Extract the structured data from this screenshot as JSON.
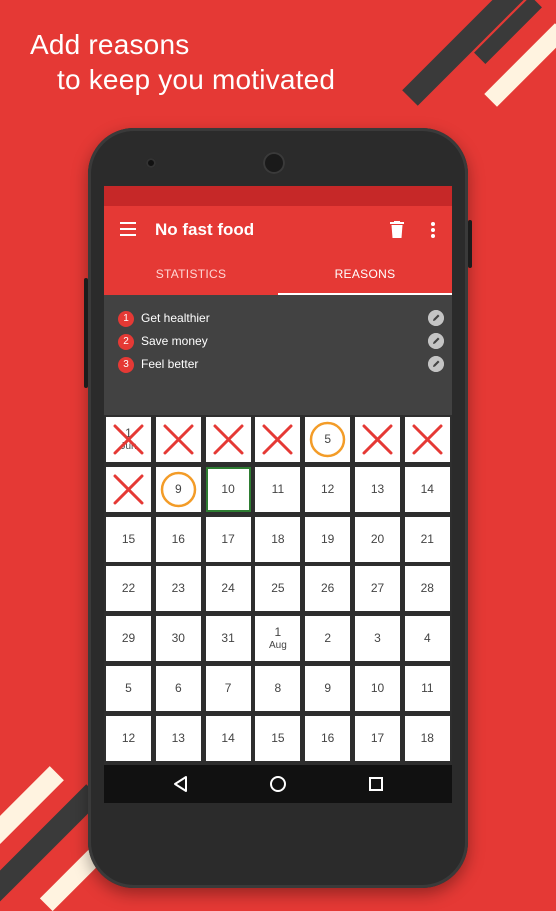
{
  "headline": {
    "line1": "Add reasons",
    "line2": "to keep you motivated"
  },
  "colors": {
    "background": "#e53935",
    "toolbar": "#e53935",
    "status_bar": "#c62828",
    "accent_x": "#e53935",
    "accent_circle": "#f39c28",
    "today_border": "#2e7d32"
  },
  "toolbar": {
    "menu_icon": "hamburger-menu-icon",
    "title": "No fast food",
    "delete_icon": "trash-icon",
    "overflow_icon": "more-vert-icon"
  },
  "tabs": [
    {
      "label": "STATISTICS",
      "active": false
    },
    {
      "label": "REASONS",
      "active": true
    }
  ],
  "reasons": [
    {
      "num": "1",
      "text": "Get healthier"
    },
    {
      "num": "2",
      "text": "Save money"
    },
    {
      "num": "3",
      "text": "Feel better"
    }
  ],
  "calendar": {
    "cells": [
      {
        "day": "1",
        "sub": "Jun",
        "mark": "x"
      },
      {
        "day": "",
        "sub": "",
        "mark": "x"
      },
      {
        "day": "",
        "sub": "",
        "mark": "x"
      },
      {
        "day": "",
        "sub": "",
        "mark": "x"
      },
      {
        "day": "5",
        "sub": "",
        "mark": "o"
      },
      {
        "day": "",
        "sub": "",
        "mark": "x"
      },
      {
        "day": "",
        "sub": "",
        "mark": "x"
      },
      {
        "day": "",
        "sub": "",
        "mark": "x"
      },
      {
        "day": "9",
        "sub": "",
        "mark": "o"
      },
      {
        "day": "10",
        "sub": "",
        "mark": "today"
      },
      {
        "day": "11",
        "sub": "",
        "mark": ""
      },
      {
        "day": "12",
        "sub": "",
        "mark": ""
      },
      {
        "day": "13",
        "sub": "",
        "mark": ""
      },
      {
        "day": "14",
        "sub": "",
        "mark": ""
      },
      {
        "day": "15",
        "sub": "",
        "mark": ""
      },
      {
        "day": "16",
        "sub": "",
        "mark": ""
      },
      {
        "day": "17",
        "sub": "",
        "mark": ""
      },
      {
        "day": "18",
        "sub": "",
        "mark": ""
      },
      {
        "day": "19",
        "sub": "",
        "mark": ""
      },
      {
        "day": "20",
        "sub": "",
        "mark": ""
      },
      {
        "day": "21",
        "sub": "",
        "mark": ""
      },
      {
        "day": "22",
        "sub": "",
        "mark": ""
      },
      {
        "day": "23",
        "sub": "",
        "mark": ""
      },
      {
        "day": "24",
        "sub": "",
        "mark": ""
      },
      {
        "day": "25",
        "sub": "",
        "mark": ""
      },
      {
        "day": "26",
        "sub": "",
        "mark": ""
      },
      {
        "day": "27",
        "sub": "",
        "mark": ""
      },
      {
        "day": "28",
        "sub": "",
        "mark": ""
      },
      {
        "day": "29",
        "sub": "",
        "mark": ""
      },
      {
        "day": "30",
        "sub": "",
        "mark": ""
      },
      {
        "day": "31",
        "sub": "",
        "mark": ""
      },
      {
        "day": "1",
        "sub": "Aug",
        "mark": ""
      },
      {
        "day": "2",
        "sub": "",
        "mark": ""
      },
      {
        "day": "3",
        "sub": "",
        "mark": ""
      },
      {
        "day": "4",
        "sub": "",
        "mark": ""
      },
      {
        "day": "5",
        "sub": "",
        "mark": ""
      },
      {
        "day": "6",
        "sub": "",
        "mark": ""
      },
      {
        "day": "7",
        "sub": "",
        "mark": ""
      },
      {
        "day": "8",
        "sub": "",
        "mark": ""
      },
      {
        "day": "9",
        "sub": "",
        "mark": ""
      },
      {
        "day": "10",
        "sub": "",
        "mark": ""
      },
      {
        "day": "11",
        "sub": "",
        "mark": ""
      },
      {
        "day": "12",
        "sub": "",
        "mark": ""
      },
      {
        "day": "13",
        "sub": "",
        "mark": ""
      },
      {
        "day": "14",
        "sub": "",
        "mark": ""
      },
      {
        "day": "15",
        "sub": "",
        "mark": ""
      },
      {
        "day": "16",
        "sub": "",
        "mark": ""
      },
      {
        "day": "17",
        "sub": "",
        "mark": ""
      },
      {
        "day": "18",
        "sub": "",
        "mark": ""
      }
    ]
  },
  "navbar": {
    "back_icon": "back-triangle-icon",
    "home_icon": "home-circle-icon",
    "recents_icon": "recents-square-icon"
  }
}
